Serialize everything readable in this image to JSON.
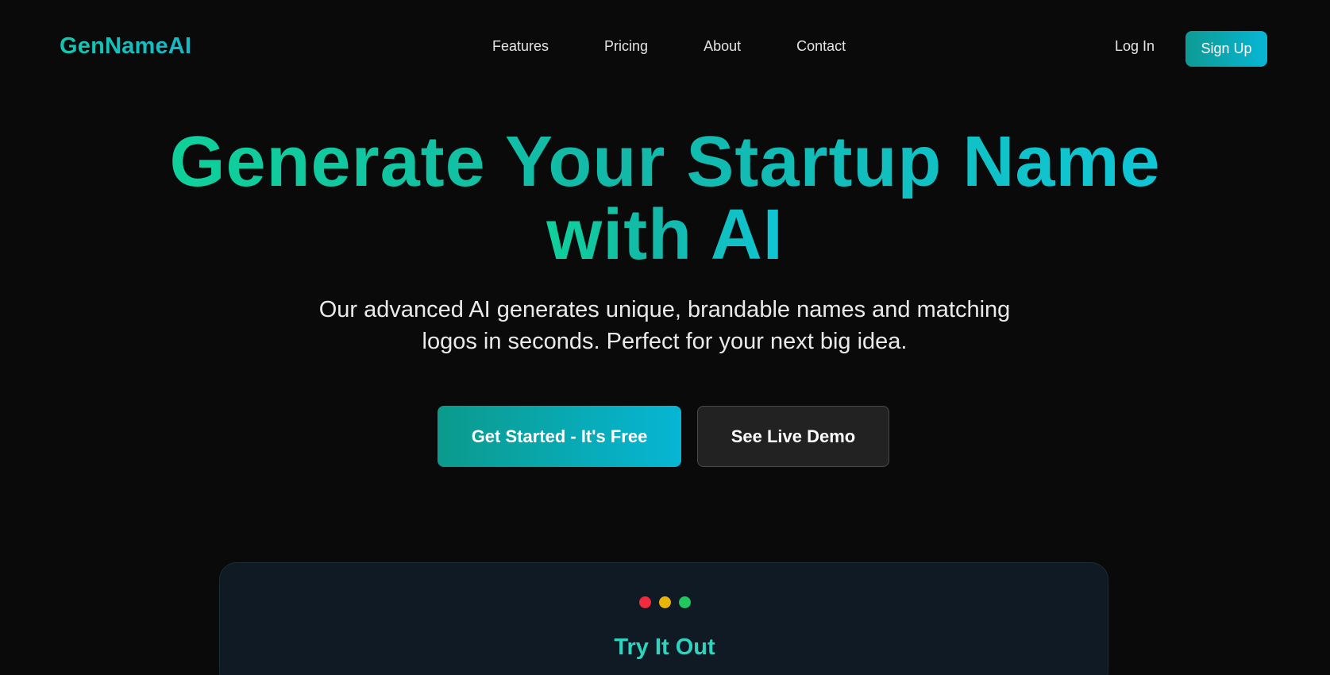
{
  "nav": {
    "brand": "GenNameAI",
    "links": [
      "Features",
      "Pricing",
      "About",
      "Contact"
    ],
    "login_label": "Log In",
    "signup_label": "Sign Up"
  },
  "hero": {
    "title_line1": "Generate Your Startup Name",
    "title_line2": "with AI",
    "subtitle_line1": "Our advanced AI generates unique, brandable names and matching",
    "subtitle_line2": "logos in seconds. Perfect for your next big idea.",
    "primary_cta": "Get Started - It's Free",
    "secondary_cta": "See Live Demo"
  },
  "demo": {
    "title": "Try It Out",
    "window_dots": [
      "red-dot",
      "yellow-dot",
      "green-dot"
    ]
  },
  "colors": {
    "background": "#0a0a0b",
    "accent_teal": "#14b8a6",
    "accent_cyan": "#06b6d4",
    "card_bg": "#0f1a24"
  }
}
